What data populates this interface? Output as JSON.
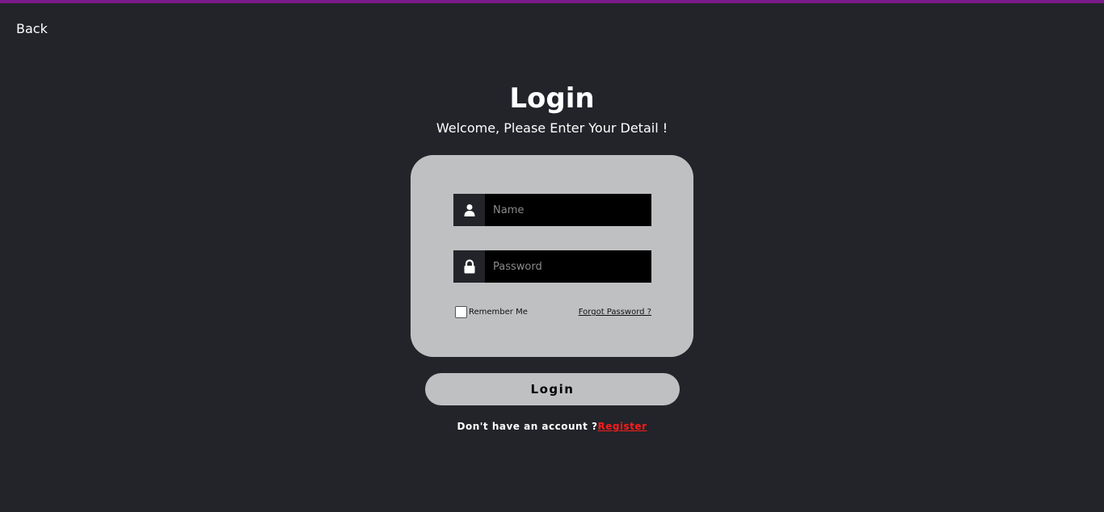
{
  "header": {
    "back_label": "Back"
  },
  "main": {
    "title": "Login",
    "subtitle": "Welcome, Please Enter Your Detail !"
  },
  "form": {
    "name_placeholder": "Name",
    "name_value": "",
    "password_placeholder": "Password",
    "password_value": "",
    "remember_label": "Remember Me",
    "remember_checked": false,
    "forgot_label": "Forgot Password ?",
    "user_icon": "user-icon",
    "lock_icon": "lock-icon"
  },
  "actions": {
    "login_label": "Login",
    "register_prompt": "Don't have an account ?",
    "register_label": "Register"
  },
  "colors": {
    "background": "#22242a",
    "accent_bar": "#7a1a8a",
    "card": "#bfc0c2",
    "register_link": "#ff1a1a"
  }
}
